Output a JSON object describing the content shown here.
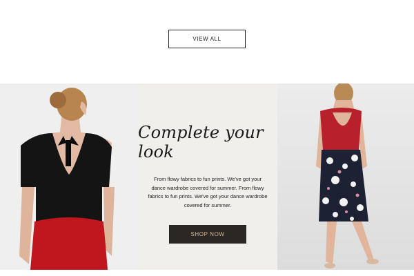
{
  "cta_top": {
    "label": "VIEW ALL"
  },
  "promo": {
    "headline": "Complete your look",
    "body": "From flowy fabrics to fun prints. We've got your dance wardrobe covered for summer. From flowy fabrics to fun prints. We've got your dance wardrobe covered for summer.",
    "button_label": "SHOP NOW"
  },
  "colors": {
    "button_dark": "#2b2724",
    "button_text": "#d8b892",
    "panel_bg": "#f1efec",
    "skirt_red": "#c0161e",
    "top_red": "#b8202c"
  }
}
